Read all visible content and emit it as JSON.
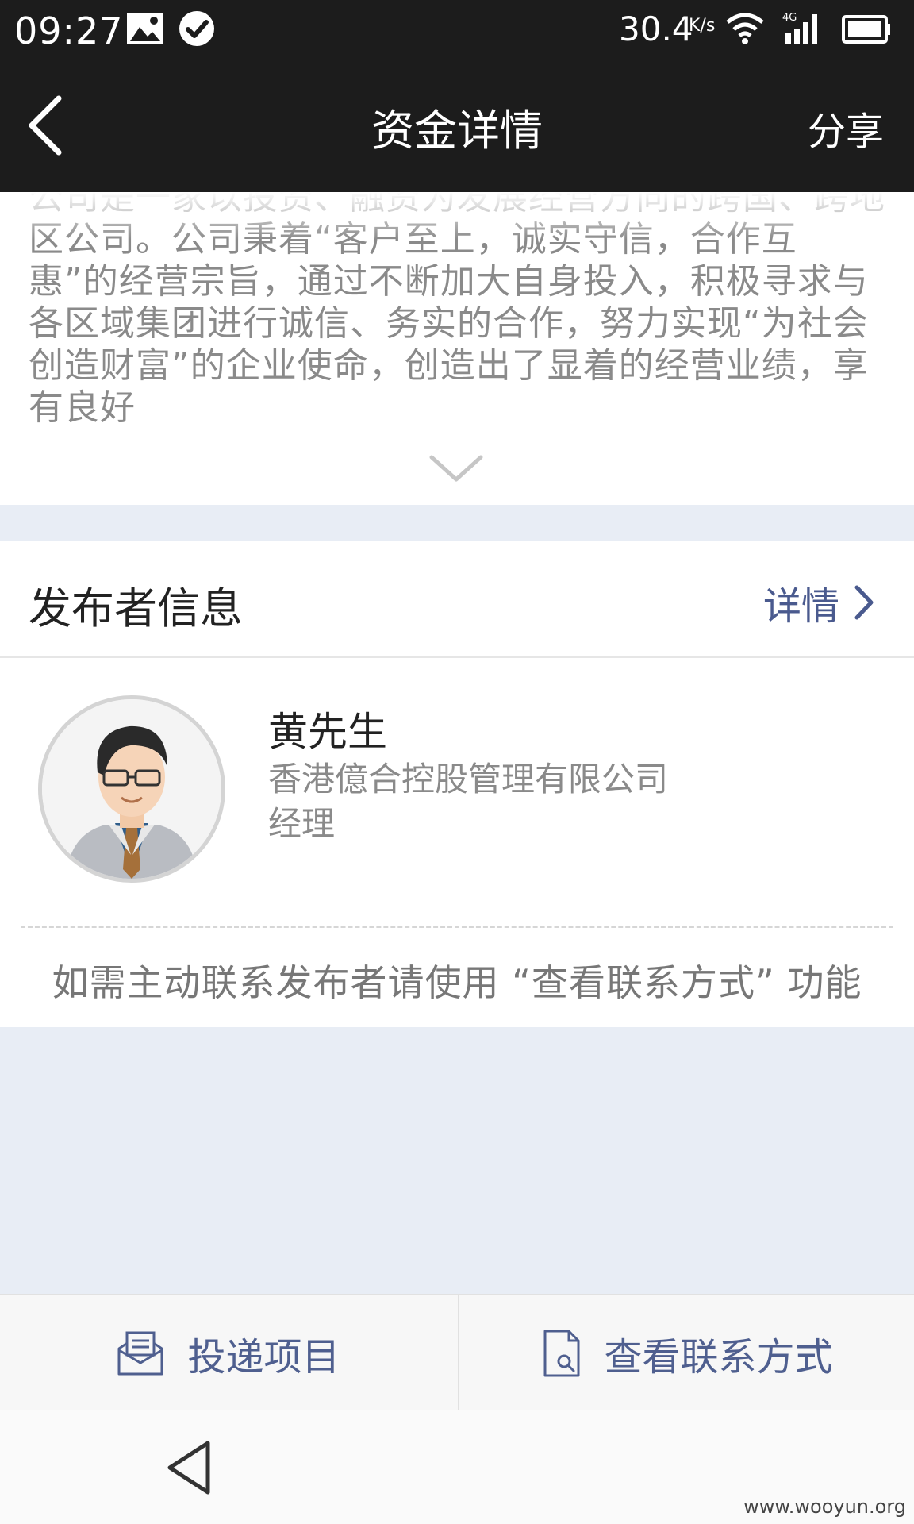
{
  "status_bar": {
    "time": "09:27",
    "net_speed": "30.4",
    "net_unit": "K/s",
    "icons": [
      "image-icon",
      "check-circle-icon",
      "wifi-icon",
      "signal-4g-icon",
      "battery-icon"
    ]
  },
  "title_bar": {
    "title": "资金详情",
    "share_label": "分享"
  },
  "description": {
    "text": "公司是一家以投资、融资为发展经营方向的跨国、跨地区公司。公司秉着“客户至上，诚实守信，合作互惠”的经营宗旨，通过不断加大自身投入，积极寻求与各区域集团进行诚信、务实的合作，努力实现“为社会创造财富”的企业使命，创造出了显着的经营业绩，享有良好"
  },
  "publisher": {
    "section_title": "发布者信息",
    "detail_label": "详情",
    "name": "黄先生",
    "company": "香港億合控股管理有限公司",
    "role": "经理",
    "notice": "如需主动联系发布者请使用 “查看联系方式” 功能"
  },
  "actions": {
    "submit_label": "投递项目",
    "contact_label": "查看联系方式"
  },
  "watermark": "www.wooyun.org",
  "colors": {
    "header_bg": "#1c1c1c",
    "page_bg": "#e8edf5",
    "accent": "#4f5f8f"
  }
}
